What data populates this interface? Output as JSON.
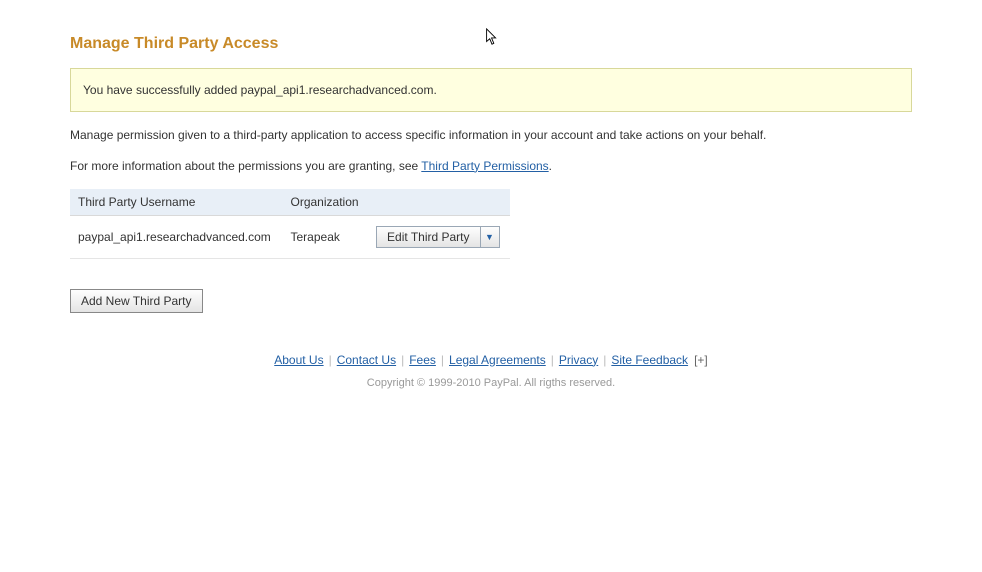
{
  "page": {
    "title": "Manage Third Party Access"
  },
  "success": {
    "message": "You have successfully added paypal_api1.researchadvanced.com."
  },
  "description": {
    "line1": "Manage permission given to a third-party application to access specific information in your account and take actions on your behalf.",
    "line2_prefix": "For more information about the permissions you are granting, see ",
    "line2_link": "Third Party Permissions",
    "line2_suffix": "."
  },
  "table": {
    "headers": {
      "username": "Third Party Username",
      "organization": "Organization",
      "actions": ""
    },
    "rows": [
      {
        "username": "paypal_api1.researchadvanced.com",
        "organization": "Terapeak",
        "edit_label": "Edit Third Party"
      }
    ]
  },
  "buttons": {
    "add_new": "Add New Third Party"
  },
  "footer": {
    "links": {
      "about": "About Us",
      "contact": "Contact Us",
      "fees": "Fees",
      "legal": "Legal Agreements",
      "privacy": "Privacy",
      "feedback": "Site Feedback"
    },
    "expand": "[+]",
    "copyright": "Copyright © 1999-2010 PayPal. All rigths reserved."
  }
}
